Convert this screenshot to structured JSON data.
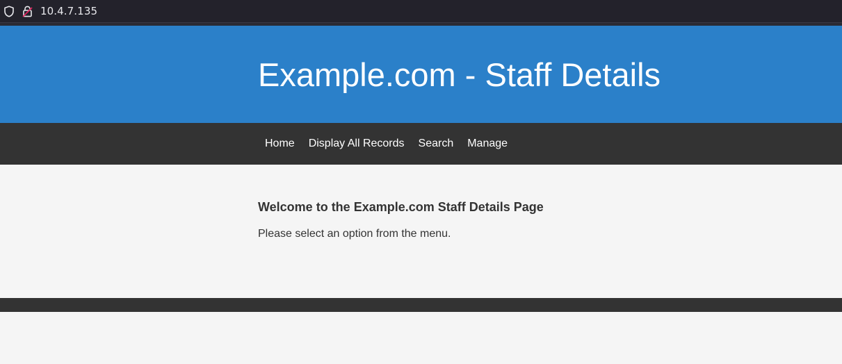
{
  "browser": {
    "url": "10.4.7.135",
    "icons": {
      "tracking": "shield-icon",
      "security": "insecure-lock-icon"
    },
    "colors": {
      "toolbar_bg": "#23222b",
      "insecure_accent": "#e0245e"
    }
  },
  "header": {
    "title": "Example.com - Staff Details",
    "bg_color": "#2b80c9"
  },
  "nav": {
    "items": [
      {
        "label": "Home"
      },
      {
        "label": "Display All Records"
      },
      {
        "label": "Search"
      },
      {
        "label": "Manage"
      }
    ],
    "bg_color": "#333333"
  },
  "main": {
    "heading": "Welcome to the Example.com Staff Details Page",
    "message": "Please select an option from the menu."
  },
  "footer": {
    "bg_color": "#333333"
  }
}
